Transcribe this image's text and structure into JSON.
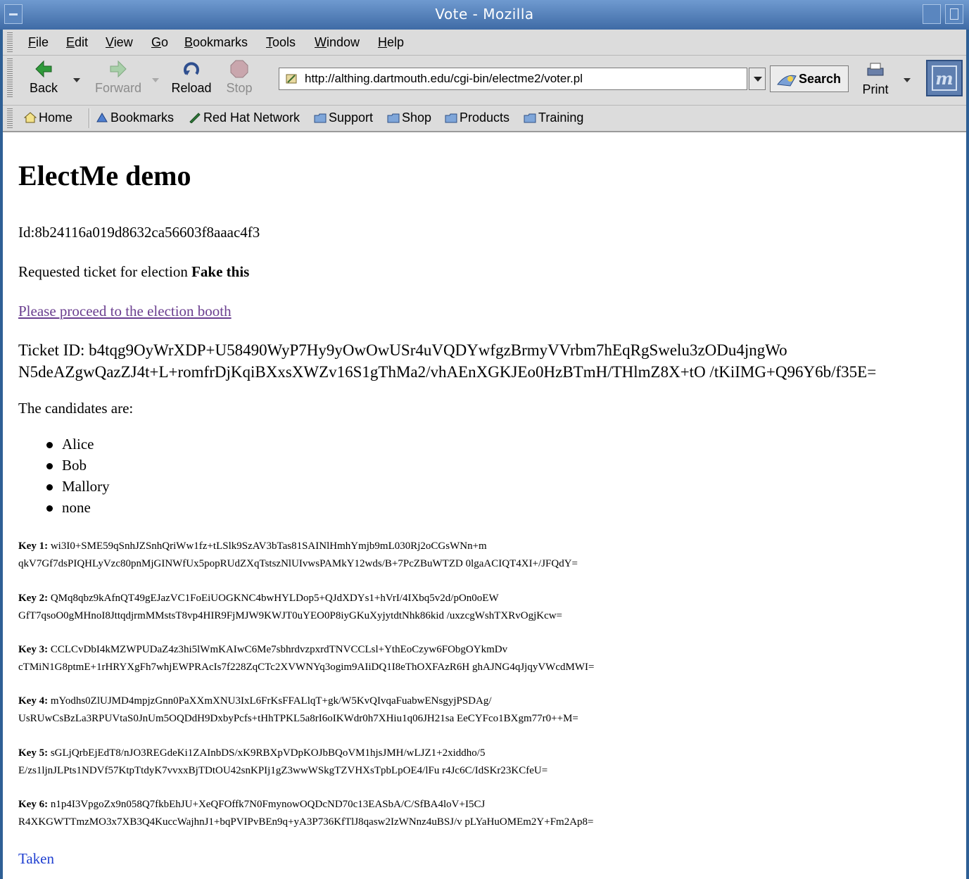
{
  "window": {
    "title": "Vote - Mozilla"
  },
  "menubar": {
    "items": [
      {
        "label": "File",
        "underline": "F",
        "rest": "ile"
      },
      {
        "label": "Edit",
        "underline": "E",
        "rest": "dit"
      },
      {
        "label": "View",
        "underline": "V",
        "rest": "iew"
      },
      {
        "label": "Go",
        "underline": "G",
        "rest": "o"
      },
      {
        "label": "Bookmarks",
        "underline": "B",
        "rest": "ookmarks"
      },
      {
        "label": "Tools",
        "underline": "T",
        "rest": "ools"
      },
      {
        "label": "Window",
        "underline": "W",
        "rest": "indow"
      },
      {
        "label": "Help",
        "underline": "H",
        "rest": "elp"
      }
    ]
  },
  "navbar": {
    "back": "Back",
    "forward": "Forward",
    "reload": "Reload",
    "stop": "Stop",
    "url": "http://althing.dartmouth.edu/cgi-bin/electme2/voter.pl",
    "search": "Search",
    "print": "Print"
  },
  "personal_toolbar": {
    "items": [
      "Home",
      "Bookmarks",
      "Red Hat Network",
      "Support",
      "Shop",
      "Products",
      "Training"
    ]
  },
  "page": {
    "heading": "ElectMe demo",
    "id_line": "Id:8b24116a019d8632ca56603f8aaac4f3",
    "requested_prefix": "Requested ticket for election ",
    "election_name": "Fake this",
    "booth_link": "Please proceed to the election booth",
    "ticket_line1": "Ticket ID: b4tqg9OyWrXDP+U58490WyP7Hy9yOwOwUSr4uVQDYwfgzBrmyVVrbm7hEqRgSwelu3zODu4jngWo",
    "ticket_line2": "N5deAZgwQazZJ4t+L+romfrDjKqiBXxsXWZv16S1gThMa2/vhAEnXGKJEo0HzBTmH/THlmZ8X+tO /tKiIMG+Q96Y6b/f35E=",
    "candidates_intro": "The candidates are:",
    "candidates": [
      "Alice",
      "Bob",
      "Mallory",
      "none"
    ],
    "keys": [
      {
        "label": "Key 1:",
        "line1": "wi3I0+SME59qSnhJZSnhQriWw1fz+tLSlk9SzAV3bTas81SAINlHmhYmjb9mL030Rj2oCGsWNn+m",
        "line2": "qkV7Gf7dsPIQHLyVzc80pnMjGINWfUx5popRUdZXqTstszNlUIvwsPAMkY12wds/B+7PcZBuWTZD 0lgaACIQT4XI+/JFQdY="
      },
      {
        "label": "Key 2:",
        "line1": "QMq8qbz9kAfnQT49gEJazVC1FoEiUOGKNC4bwHYLDop5+QJdXDYs1+hVrI/4IXbq5v2d/pOn0oEW",
        "line2": "GfT7qsoO0gMHnoI8JttqdjrmMMstsT8vp4HIR9FjMJW9KWJT0uYEO0P8iyGKuXyjytdtNhk86kid /uxzcgWshTXRvOgjKcw="
      },
      {
        "label": "Key 3:",
        "line1": "CCLCvDbI4kMZWPUDaZ4z3hi5lWmKAIwC6Me7sbhrdvzpxrdTNVCCLsl+YthEoCzyw6FObgOYkmDv",
        "line2": "cTMiN1G8ptmE+1rHRYXgFh7whjEWPRAcIs7f228ZqCTc2XVWNYq3ogim9AIiDQ1I8eThOXFAzR6H ghAJNG4qJjqyVWcdMWI="
      },
      {
        "label": "Key 4:",
        "line1": "mYodhs0ZlUJMD4mpjzGnn0PaXXmXNU3IxL6FrKsFFALlqT+gk/W5KvQIvqaFuabwENsgyjPSDAg/",
        "line2": "UsRUwCsBzLa3RPUVtaS0JnUm5OQDdH9DxbyPcfs+tHhTPKL5a8rI6oIKWdr0h7XHiu1q06JH21sa EeCYFco1BXgm77r0++M="
      },
      {
        "label": "Key 5:",
        "line1": "sGLjQrbEjEdT8/nJO3REGdeKi1ZAInbDS/xK9RBXpVDpKOJbBQoVM1hjsJMH/wLJZ1+2xiddho/5",
        "line2": "E/zs1ljnJLPts1NDVf57KtpTtdyK7vvxxBjTDtOU42snKPIj1gZ3wwWSkgTZVHXsTpbLpOE4/lFu r4Jc6C/IdSKr23KCfeU="
      },
      {
        "label": "Key 6:",
        "line1": "n1p4I3VpgoZx9n058Q7fkbEhJU+XeQFOffk7N0FmynowOQDcND70c13EASbA/C/SfBA4loV+I5CJ",
        "line2": "R4XKGWTTmzMO3x7XB3Q4KuccWajhnJ1+bqPVIPvBEn9q+yA3P736KfTlJ8qasw2IzWNnz4uBSJ/v pLYaHuOMEm2Y+Fm2Ap8="
      }
    ],
    "taken": "Taken"
  }
}
